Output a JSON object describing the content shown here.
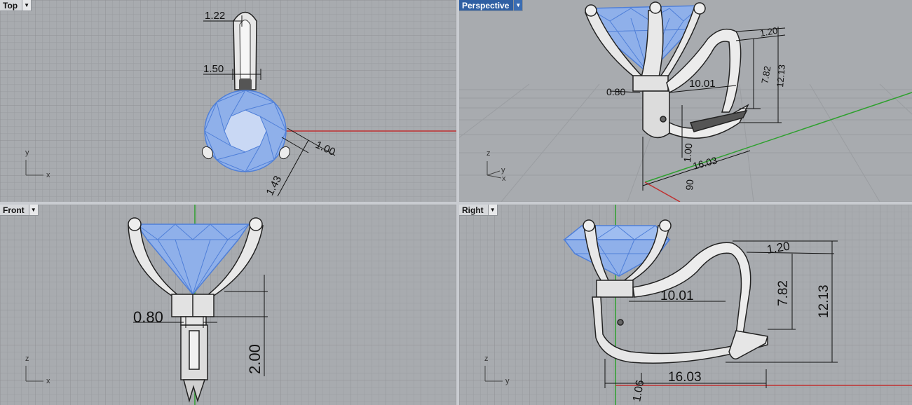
{
  "viewports": {
    "top": {
      "label": "Top",
      "dims": {
        "d1": "1.22",
        "d2": "1.50",
        "d3": "1.00",
        "d4": "1.43"
      },
      "axes": {
        "a": "y",
        "b": "x"
      }
    },
    "perspective": {
      "label": "Perspective",
      "dims": {
        "d1": "1.20",
        "d2": "7.82",
        "d3": "12.13",
        "d4": "10.01",
        "d5": "0.80",
        "d6": "16.03",
        "d7": "1.00",
        "d8": "90"
      },
      "axes": {
        "a": "z",
        "b": "y",
        "c": "x"
      }
    },
    "front": {
      "label": "Front",
      "dims": {
        "d1": "0.80",
        "d2": "2.00"
      },
      "axes": {
        "a": "z",
        "b": "x"
      }
    },
    "right": {
      "label": "Right",
      "dims": {
        "d1": "1.20",
        "d2": "7.82",
        "d3": "12.13",
        "d4": "10.01",
        "d5": "16.03",
        "d6": "1.06"
      },
      "axes": {
        "a": "z",
        "b": "y"
      }
    }
  },
  "colors": {
    "background": "#a8abaf",
    "grid": "#9a9da1",
    "grid_major": "#8c8f93",
    "gem": "#8fb0ea",
    "gem_edge": "#4f7fd8",
    "metal": "#e7e7e7",
    "x_axis": "#c03030",
    "y_axis": "#2ea02e"
  },
  "icons": {
    "dropdown": "caret-down-icon"
  }
}
